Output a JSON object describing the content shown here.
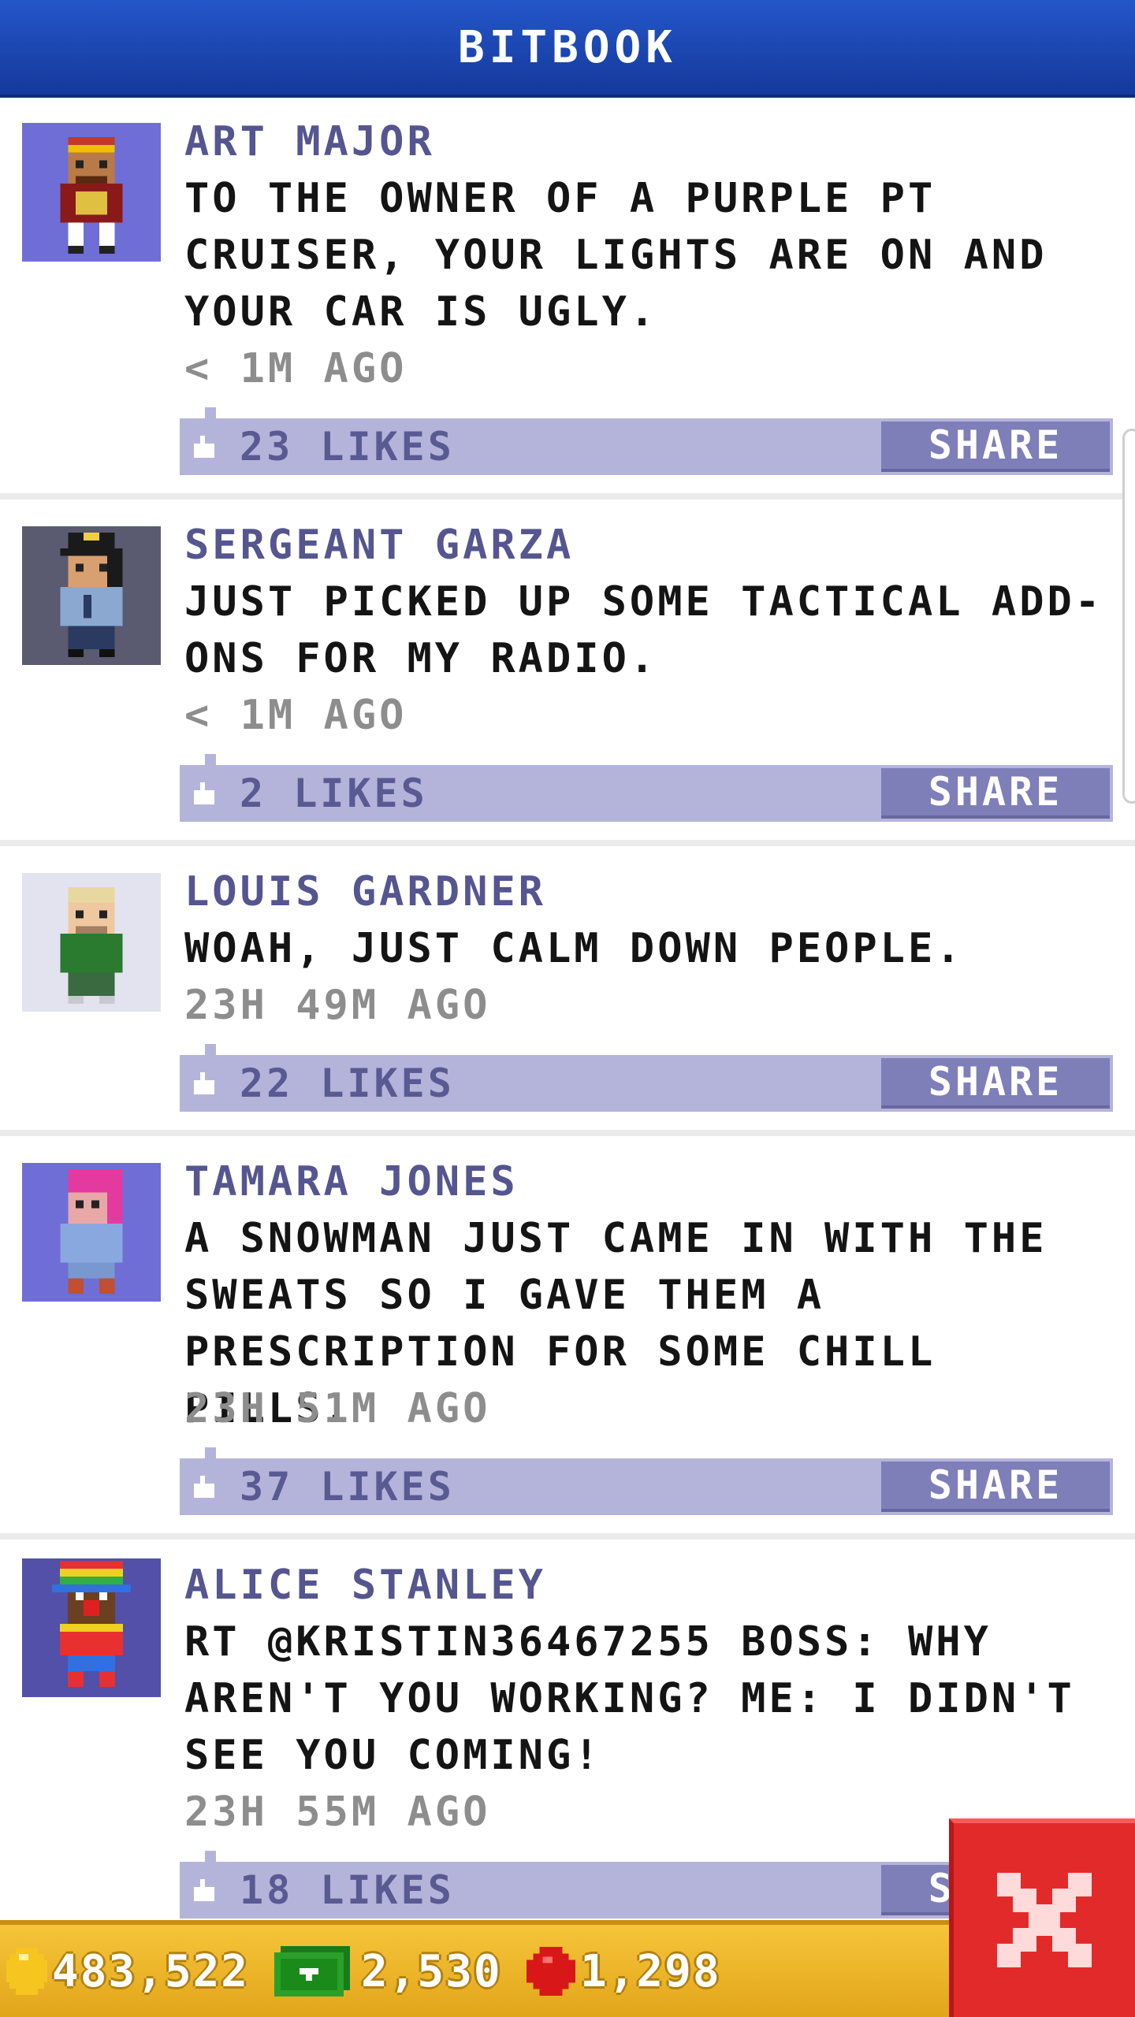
{
  "header": {
    "title": "BITBOOK"
  },
  "posts": [
    {
      "author": "ART MAJOR",
      "text": "TO THE OWNER OF A PURPLE PT CRUISER, YOUR LIGHTS ARE ON AND YOUR CAR IS UGLY.",
      "time": "< 1M AGO",
      "likes": "23 LIKES",
      "share": "SHARE",
      "avatar_icon": "bellhop-avatar-icon"
    },
    {
      "author": "SERGEANT GARZA",
      "text": "JUST PICKED UP SOME TACTICAL ADD-ONS FOR MY RADIO.",
      "time": "< 1M AGO",
      "likes": "2 LIKES",
      "share": "SHARE",
      "avatar_icon": "police-officer-avatar-icon"
    },
    {
      "author": "LOUIS GARDNER",
      "text": "WOAH, JUST CALM DOWN PEOPLE.",
      "time": "23H 49M AGO",
      "likes": "22 LIKES",
      "share": "SHARE",
      "avatar_icon": "blond-man-avatar-icon"
    },
    {
      "author": "TAMARA JONES",
      "text": "A SNOWMAN JUST CAME IN WITH THE SWEATS SO I GAVE THEM A PRESCRIPTION FOR SOME CHILL PILLS.",
      "time": "23H 51M AGO",
      "likes": "37 LIKES",
      "share": "SHARE",
      "avatar_icon": "pink-hair-woman-avatar-icon"
    },
    {
      "author": "ALICE STANLEY",
      "text": "RT @KRISTIN36467255 BOSS: WHY AREN'T YOU WORKING? ME: I DIDN'T SEE YOU COMING!",
      "time": "23H 55M AGO",
      "likes": "18 LIKES",
      "share": "SHARE",
      "avatar_icon": "clown-avatar-icon"
    }
  ],
  "footer": {
    "coins": "483,522",
    "bux": "2,530",
    "gems": "1,298",
    "coin_icon": "gold-coin-icon",
    "bux_icon": "tower-bux-icon",
    "gem_icon": "red-gem-icon"
  },
  "close_icon": "close-x-icon"
}
